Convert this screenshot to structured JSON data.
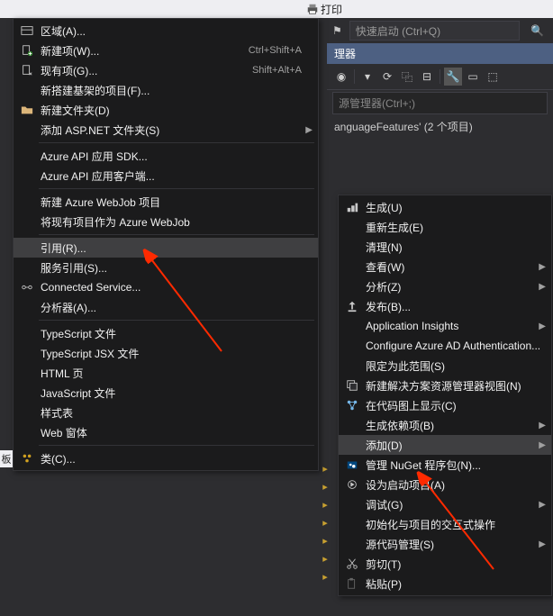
{
  "top": {
    "print_label": "打印"
  },
  "quick_launch": {
    "placeholder": "快速启动 (Ctrl+Q)"
  },
  "panel": {
    "title": "理器",
    "search_placeholder": "源管理器(Ctrl+;)",
    "solution_line": "anguageFeatures' (2 个项目)"
  },
  "left_menu": {
    "items": [
      {
        "icon": "area-icon",
        "label": "区域(A)..."
      },
      {
        "icon": "newitem-icon",
        "label": "新建项(W)...",
        "shortcut": "Ctrl+Shift+A"
      },
      {
        "icon": "existitem-icon",
        "label": "现有项(G)...",
        "shortcut": "Shift+Alt+A"
      },
      {
        "icon": "",
        "label": "新搭建基架的项目(F)..."
      },
      {
        "icon": "folder-icon",
        "label": "新建文件夹(D)"
      },
      {
        "icon": "",
        "label": "添加 ASP.NET 文件夹(S)",
        "arrow": true,
        "sep_after": true
      },
      {
        "icon": "",
        "label": "Azure API 应用 SDK..."
      },
      {
        "icon": "",
        "label": "Azure API 应用客户端...",
        "sep_after": true
      },
      {
        "icon": "",
        "label": "新建 Azure WebJob 项目"
      },
      {
        "icon": "",
        "label": "将现有项目作为 Azure WebJob",
        "sep_after": true
      },
      {
        "icon": "",
        "label": "引用(R)...",
        "highlight": true
      },
      {
        "icon": "",
        "label": "服务引用(S)..."
      },
      {
        "icon": "connected-icon",
        "label": "Connected Service..."
      },
      {
        "icon": "",
        "label": "分析器(A)...",
        "sep_after": true
      },
      {
        "icon": "",
        "label": "TypeScript 文件"
      },
      {
        "icon": "",
        "label": "TypeScript JSX 文件"
      },
      {
        "icon": "",
        "label": "HTML 页"
      },
      {
        "icon": "",
        "label": "JavaScript 文件"
      },
      {
        "icon": "",
        "label": "样式表"
      },
      {
        "icon": "",
        "label": "Web 窗体",
        "sep_after": true
      },
      {
        "icon": "class-icon",
        "label": "类(C)..."
      }
    ]
  },
  "right_menu": {
    "items": [
      {
        "icon": "build-icon",
        "label": "生成(U)"
      },
      {
        "icon": "",
        "label": "重新生成(E)"
      },
      {
        "icon": "",
        "label": "清理(N)"
      },
      {
        "icon": "",
        "label": "查看(W)",
        "arrow": true
      },
      {
        "icon": "",
        "label": "分析(Z)",
        "arrow": true
      },
      {
        "icon": "publish-icon",
        "label": "发布(B)..."
      },
      {
        "icon": "",
        "label": "Application Insights",
        "arrow": true
      },
      {
        "icon": "",
        "label": "Configure Azure AD Authentication..."
      },
      {
        "icon": "",
        "label": "限定为此范围(S)"
      },
      {
        "icon": "newview-icon",
        "label": "新建解决方案资源管理器视图(N)"
      },
      {
        "icon": "codemap-icon",
        "label": "在代码图上显示(C)"
      },
      {
        "icon": "",
        "label": "生成依赖项(B)",
        "arrow": true
      },
      {
        "icon": "",
        "label": "添加(D)",
        "arrow": true,
        "highlight": true
      },
      {
        "icon": "nuget-icon",
        "label": "管理 NuGet 程序包(N)..."
      },
      {
        "icon": "startup-icon",
        "label": "设为启动项目(A)"
      },
      {
        "icon": "",
        "label": "调试(G)",
        "arrow": true
      },
      {
        "icon": "",
        "label": "初始化与项目的交互式操作"
      },
      {
        "icon": "",
        "label": "源代码管理(S)",
        "arrow": true
      },
      {
        "icon": "cut-icon",
        "label": "剪切(T)"
      },
      {
        "icon": "paste-icon",
        "label": "粘贴(P)"
      }
    ]
  },
  "side_tab": {
    "label": "板"
  }
}
